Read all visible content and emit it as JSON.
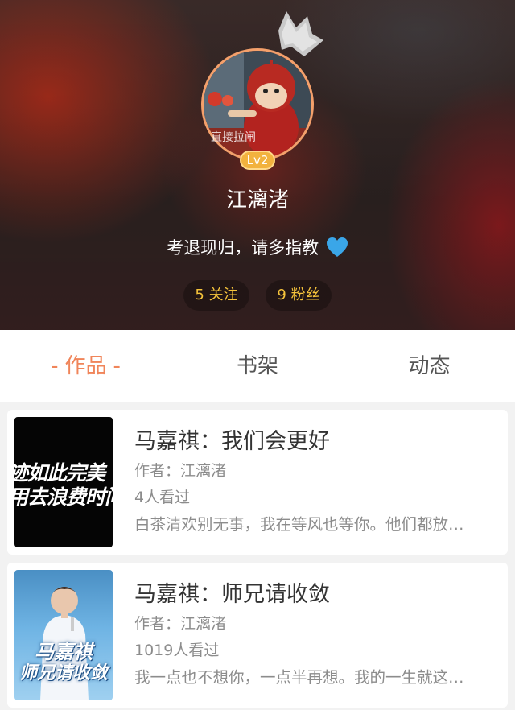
{
  "profile": {
    "name": "江漓渚",
    "level": "Lv2",
    "bio": "考退现归，请多指教",
    "avatar_caption": "直接拉闸",
    "stats": {
      "following": "5 关注",
      "followers": "9 粉丝"
    }
  },
  "tabs": [
    {
      "label": "作品",
      "active": true,
      "decor": "-"
    },
    {
      "label": "书架",
      "active": false
    },
    {
      "label": "动态",
      "active": false
    }
  ],
  "works": [
    {
      "title": "马嘉祺：我们会更好",
      "author": "作者：江漓渚",
      "views": "4人看过",
      "description": "白茶清欢别无事，我在等风也等你。他们都放…",
      "cover_lines": [
        "迹如此完美",
        "用去浪费时间"
      ]
    },
    {
      "title": "马嘉祺：师兄请收敛",
      "author": "作者：江漓渚",
      "views": "1019人看过",
      "description": "我一点也不想你，一点半再想。我的一生就这…",
      "cover_lines": [
        "马嘉祺",
        "师兄请收敛"
      ]
    }
  ],
  "colors": {
    "accent": "#f0855a",
    "stat_text": "#f5c33b",
    "level_badge": "#f2b23e",
    "heart": "#3aa6e8"
  }
}
